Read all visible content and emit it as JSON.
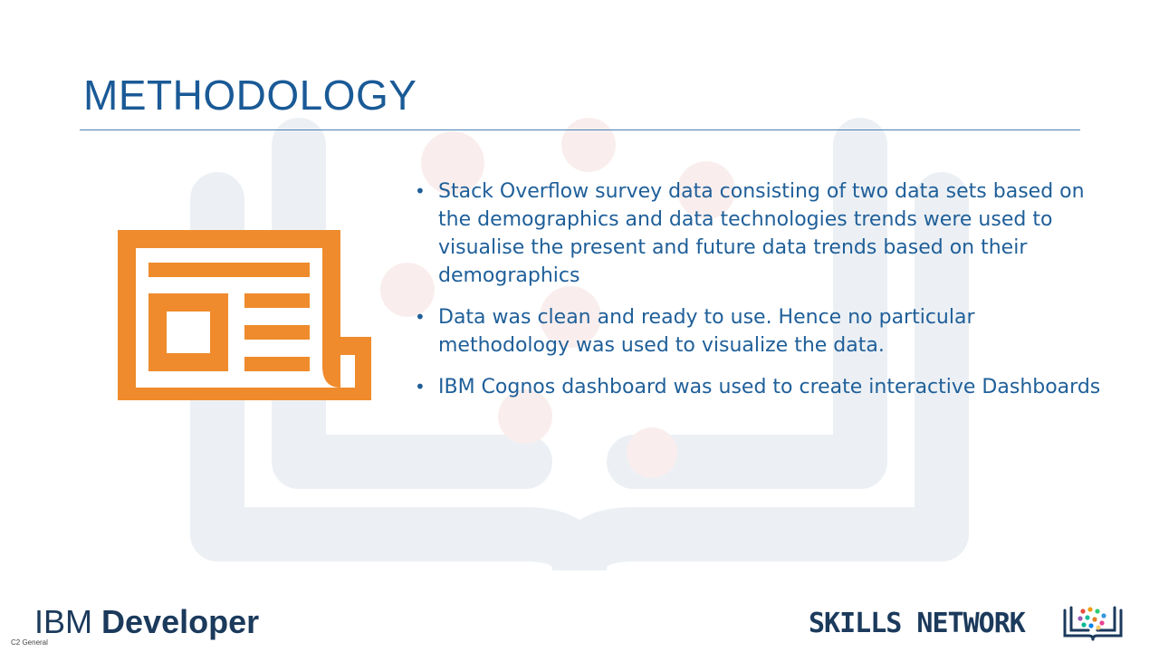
{
  "slide": {
    "title": "METHODOLOGY",
    "bullets": [
      "Stack Overflow survey data consisting of two data sets based on the demographics and data technologies trends were used to visualise the present and future data trends based on their demographics",
      "Data was clean and ready to use. Hence no particular methodology was used to visualize the data.",
      "IBM Cognos dashboard was used to create interactive Dashboards"
    ],
    "icon": "newspaper-icon"
  },
  "footer": {
    "ibm_logo_word": "IBM",
    "ibm_logo_product": "Developer",
    "classification": "C2 General",
    "skills_network": "SKILLS NETWORK",
    "skills_icon": "book-network-icon"
  },
  "colors": {
    "title": "#1a5a96",
    "text": "#1f5f99",
    "icon_orange": "#ef8b2c",
    "logo_navy": "#1b3a5c"
  }
}
